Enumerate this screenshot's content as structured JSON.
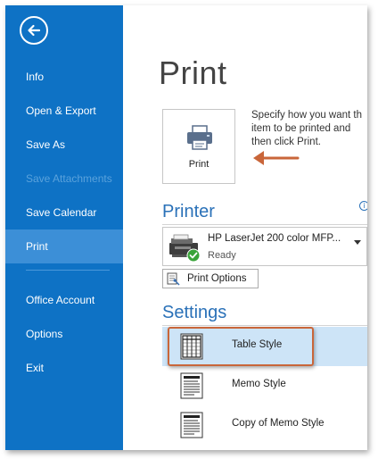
{
  "sidebar": {
    "items": [
      {
        "label": "Info",
        "state": "normal"
      },
      {
        "label": "Open & Export",
        "state": "normal"
      },
      {
        "label": "Save As",
        "state": "normal"
      },
      {
        "label": "Save Attachments",
        "state": "disabled"
      },
      {
        "label": "Save Calendar",
        "state": "normal"
      },
      {
        "label": "Print",
        "state": "active"
      },
      {
        "label": "Office Account",
        "state": "normal"
      },
      {
        "label": "Options",
        "state": "normal"
      },
      {
        "label": "Exit",
        "state": "normal"
      }
    ]
  },
  "main": {
    "title": "Print",
    "print_button": {
      "label": "Print"
    },
    "description": [
      "Specify how you want th",
      "item to be printed and",
      "then click Print."
    ],
    "printer": {
      "heading": "Printer",
      "name": "HP LaserJet 200 color MFP...",
      "status": "Ready",
      "options_label": "Print Options"
    },
    "settings": {
      "heading": "Settings",
      "styles": [
        {
          "label": "Table Style",
          "selected": true
        },
        {
          "label": "Memo Style",
          "selected": false
        },
        {
          "label": "Copy of Memo Style",
          "selected": false
        }
      ]
    }
  },
  "colors": {
    "sidebar_bg": "#0e72c5",
    "sidebar_active": "#3c8fd7",
    "heading_blue": "#2a71b8",
    "selected_bg": "#cde4f7",
    "annotation_orange": "#c9663a"
  }
}
